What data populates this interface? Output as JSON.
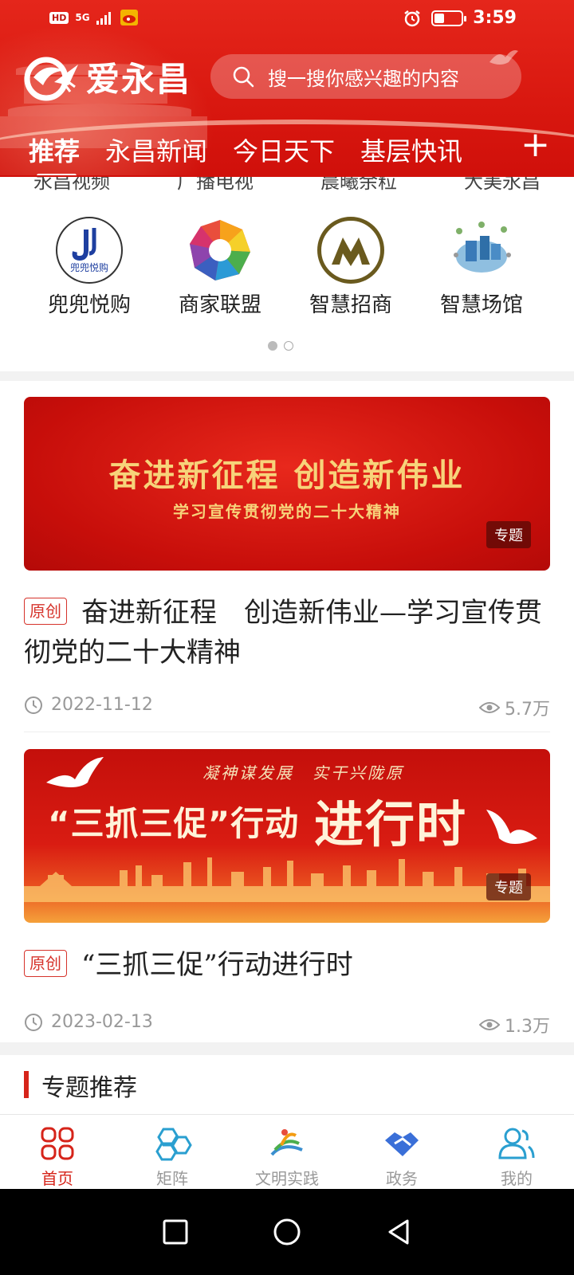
{
  "status_bar": {
    "hd": "HD",
    "network": "5G",
    "time": "3:59"
  },
  "app": {
    "name": "爱永昌"
  },
  "search": {
    "placeholder": "搜一搜你感兴趣的内容"
  },
  "tabs": [
    {
      "label": "推荐",
      "active": true
    },
    {
      "label": "永昌新闻"
    },
    {
      "label": "今日天下"
    },
    {
      "label": "基层快讯"
    }
  ],
  "quick_prev_row": [
    "永昌视频",
    "广播电视",
    "晨曦余粒",
    "大美永昌"
  ],
  "quick_items": [
    {
      "label": "兜兜悦购",
      "icon": "doudou-icon",
      "icon_text": "兜兜悦购"
    },
    {
      "label": "商家联盟",
      "icon": "merchant-alliance-icon"
    },
    {
      "label": "智慧招商",
      "icon": "smart-investment-icon"
    },
    {
      "label": "智慧场馆",
      "icon": "smart-venue-icon"
    }
  ],
  "articles": [
    {
      "banner_title": "奋进新征程 创造新伟业",
      "banner_subtitle": "学习宣传贯彻党的二十大精神",
      "tag": "专题",
      "badge": "原创",
      "title": "奋进新征程　创造新伟业—学习宣传贯彻党的二十大精神",
      "date": "2022-11-12",
      "views": "5.7万"
    },
    {
      "banner_top": "凝神谋发展　实干兴陇原",
      "banner_main": "“三抓三促”行动",
      "banner_big": "进行时",
      "tag": "专题",
      "badge": "原创",
      "title": "“三抓三促”行动进行时",
      "date": "2023-02-13",
      "views": "1.3万"
    }
  ],
  "section": {
    "title": "专题推荐"
  },
  "bottom_nav": [
    {
      "label": "首页",
      "active": true,
      "icon": "home-grid-icon"
    },
    {
      "label": "矩阵",
      "icon": "matrix-icon"
    },
    {
      "label": "文明实践",
      "icon": "civilization-practice-icon"
    },
    {
      "label": "政务",
      "icon": "government-handshake-icon"
    },
    {
      "label": "我的",
      "icon": "user-profile-icon"
    }
  ],
  "colors": {
    "brand_red": "#d6241a",
    "header_red": "#e5261b",
    "banner_gold": "#f7d37a",
    "muted_text": "#999999",
    "nav_blue": "#2a9fd0"
  }
}
